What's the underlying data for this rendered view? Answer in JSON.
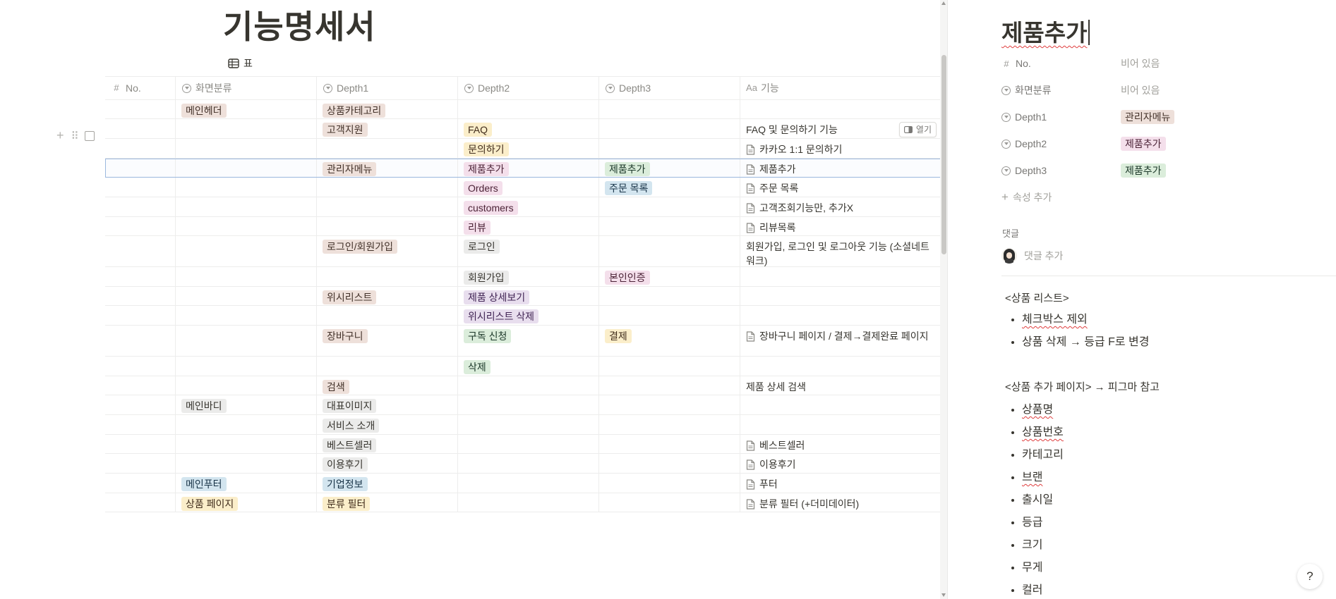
{
  "page": {
    "title": "기능명세서",
    "view_tab": "표"
  },
  "columns": [
    {
      "label": "No.",
      "icon": "hash-icon"
    },
    {
      "label": "화면분류",
      "icon": "select-icon"
    },
    {
      "label": "Depth1",
      "icon": "select-icon"
    },
    {
      "label": "Depth2",
      "icon": "select-icon"
    },
    {
      "label": "Depth3",
      "icon": "select-icon"
    },
    {
      "label": "기능",
      "icon": "text-aa-icon",
      "icon_text": "Aa"
    }
  ],
  "rows": [
    {
      "screen": "메인헤더",
      "d1": "상품카테고리",
      "d2": "",
      "d3": "",
      "func": ""
    },
    {
      "screen": "",
      "d1": "고객지원",
      "d2": "FAQ",
      "d3": "",
      "func": "FAQ 및 문의하기 기능"
    },
    {
      "screen": "",
      "d1": "",
      "d2": "문의하기",
      "d3": "",
      "func": "카카오 1:1 문의하기"
    },
    {
      "screen": "",
      "d1": "관리자메뉴",
      "d2": "제품추가",
      "d3": "제품추가",
      "func": "제품추가"
    },
    {
      "screen": "",
      "d1": "",
      "d2": "Orders",
      "d3": "주문 목록",
      "func": "주문 목록"
    },
    {
      "screen": "",
      "d1": "",
      "d2": "customers",
      "d3": "",
      "func": "고객조회기능만, 추가X"
    },
    {
      "screen": "",
      "d1": "",
      "d2": "리뷰",
      "d3": "",
      "func": "리뷰목록"
    },
    {
      "screen": "",
      "d1": "로그인/회원가입",
      "d2": "로그인",
      "d3": "",
      "func": "회원가입, 로그인 및 로그아웃 기능 (소셜네트워크)"
    },
    {
      "screen": "",
      "d1": "",
      "d2": "회원가입",
      "d3": "본인인증",
      "func": ""
    },
    {
      "screen": "",
      "d1": "위시리스트",
      "d2": "제품 상세보기",
      "d3": "",
      "func": ""
    },
    {
      "screen": "",
      "d1": "",
      "d2": "위시리스트 삭제",
      "d3": "",
      "func": ""
    },
    {
      "screen": "",
      "d1": "장바구니",
      "d2": "구독 신청",
      "d3": "결제",
      "func": "장바구니 페이지 / 결제→결제완료 페이지"
    },
    {
      "screen": "",
      "d1": "",
      "d2": "삭제",
      "d3": "",
      "func": ""
    },
    {
      "screen": "",
      "d1": "검색",
      "d2": "",
      "d3": "",
      "func": "제품 상세 검색"
    },
    {
      "screen": "메인바디",
      "d1": "대표이미지",
      "d2": "",
      "d3": "",
      "func": ""
    },
    {
      "screen": "",
      "d1": "서비스 소개",
      "d2": "",
      "d3": "",
      "func": ""
    },
    {
      "screen": "",
      "d1": "베스트셀러",
      "d2": "",
      "d3": "",
      "func": "베스트셀러"
    },
    {
      "screen": "",
      "d1": "이용후기",
      "d2": "",
      "d3": "",
      "func": "이용후기"
    },
    {
      "screen": "메인푸터",
      "d1": "기업정보",
      "d2": "",
      "d3": "",
      "func": "푸터"
    },
    {
      "screen": "상품 페이지",
      "d1": "분류 필터",
      "d2": "",
      "d3": "",
      "func": "분류 필터 (+더미데이터)"
    }
  ],
  "open_button": "열기",
  "side_panel": {
    "title": "제품추가",
    "properties": [
      {
        "name": "No.",
        "value": "비어 있음"
      },
      {
        "name": "화면분류",
        "value": "비어 있음"
      },
      {
        "name": "Depth1",
        "value": "관리자메뉴"
      },
      {
        "name": "Depth2",
        "value": "제품추가"
      },
      {
        "name": "Depth3",
        "value": "제품추가"
      }
    ],
    "add_property": "속성 추가",
    "comments_label": "댓글",
    "add_comment": "댓글 추가",
    "section1_title": "<상품 리스트>",
    "section1_items": [
      "체크박스 제외",
      "상품 삭제 → 등급 F로 변경"
    ],
    "section2_title": "<상품 추가 페이지> → 피그마 참고",
    "section2_items": [
      "상품명",
      "상품번호",
      "카테고리",
      "브랜",
      "출시일",
      "등급",
      "크기",
      "무게",
      "컬러"
    ]
  },
  "help_button": "?",
  "colors": {
    "brown": "#eee0da",
    "gray": "#ebebea",
    "yellow": "#fbeeca",
    "pink": "#f4dfeb",
    "green": "#dbeddb",
    "blue": "#d3e5ef",
    "purple": "#e8deee",
    "selection": "#9bb8de"
  }
}
